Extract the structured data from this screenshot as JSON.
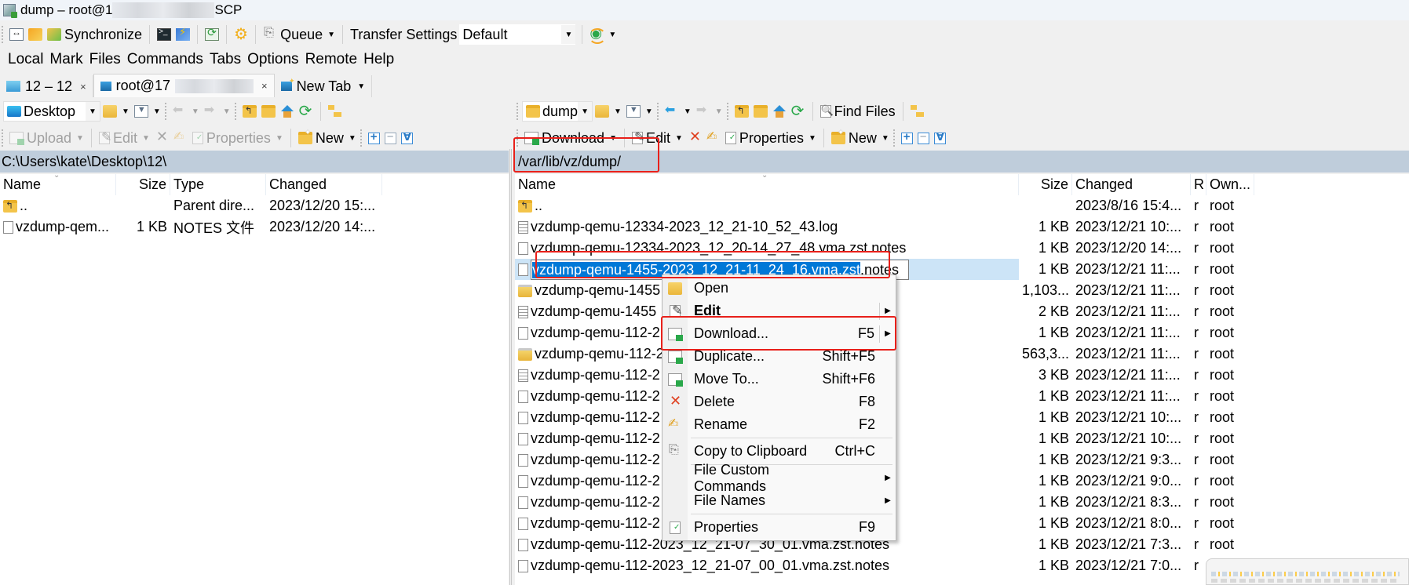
{
  "window": {
    "title_prefix": "dump – root@1",
    "title_suffix": "SCP"
  },
  "main_toolbar": {
    "synchronize_label": "Synchronize",
    "queue_label": "Queue",
    "transfer_settings_label": "Transfer Settings",
    "transfer_settings_value": "Default"
  },
  "menubar": {
    "items": [
      "Local",
      "Mark",
      "Files",
      "Commands",
      "Tabs",
      "Options",
      "Remote",
      "Help"
    ]
  },
  "tabs": [
    {
      "label": "12 – 12",
      "close": "×"
    },
    {
      "label": "root@17",
      "close": "×"
    },
    {
      "label": "New Tab"
    }
  ],
  "local": {
    "location": "Desktop",
    "toolbar": {
      "upload_label": "Upload",
      "edit_label": "Edit",
      "properties_label": "Properties",
      "new_label": "New"
    },
    "path": "C:\\Users\\kate\\Desktop\\12\\",
    "columns": [
      "Name",
      "Size",
      "Type",
      "Changed"
    ],
    "rows": [
      {
        "name": "..",
        "size": "",
        "type": "Parent dire...",
        "changed": "2023/12/20 15:...",
        "icon": "folder-up-icon"
      },
      {
        "name": "vzdump-qem...",
        "size": "1 KB",
        "type": "NOTES 文件",
        "changed": "2023/12/20 14:...",
        "icon": "file-icon"
      }
    ]
  },
  "remote": {
    "location": "dump",
    "toolbar": {
      "find_files_label": "Find Files",
      "download_label": "Download",
      "edit_label": "Edit",
      "properties_label": "Properties",
      "new_label": "New"
    },
    "path": "/var/lib/vz/dump/",
    "columns": [
      "Name",
      "Size",
      "Changed",
      "R",
      "Own..."
    ],
    "rows": [
      {
        "name": "..",
        "size": "",
        "changed": "2023/8/16 15:4...",
        "rights": "r",
        "owner": "root",
        "icon": "folder-up-icon"
      },
      {
        "name": "vzdump-qemu-12334-2023_12_21-10_52_43.log",
        "size": "1 KB",
        "changed": "2023/12/21 10:...",
        "rights": "r",
        "owner": "root",
        "icon": "text-file-icon"
      },
      {
        "name": "vzdump-qemu-12334-2023_12_20-14_27_48.vma.zst.notes",
        "size": "1 KB",
        "changed": "2023/12/20 14:...",
        "rights": "r",
        "owner": "root",
        "icon": "file-icon"
      },
      {
        "name": "vzdump-qemu-1455-2023_12_21-11_24_16.vma.zst.notes",
        "size": "1 KB",
        "changed": "2023/12/21 11:...",
        "rights": "r",
        "owner": "root",
        "icon": "file-icon",
        "selected": true
      },
      {
        "name": "vzdump-qemu-1455",
        "size": "1,103...",
        "changed": "2023/12/21 11:...",
        "rights": "r",
        "owner": "root",
        "icon": "archive-icon"
      },
      {
        "name": "vzdump-qemu-1455",
        "size": "2 KB",
        "changed": "2023/12/21 11:...",
        "rights": "r",
        "owner": "root",
        "icon": "text-file-icon"
      },
      {
        "name": "vzdump-qemu-112-2",
        "size": "1 KB",
        "changed": "2023/12/21 11:...",
        "rights": "r",
        "owner": "root",
        "icon": "file-icon"
      },
      {
        "name": "vzdump-qemu-112-2",
        "size": "563,3...",
        "changed": "2023/12/21 11:...",
        "rights": "r",
        "owner": "root",
        "icon": "archive-icon"
      },
      {
        "name": "vzdump-qemu-112-2",
        "size": "3 KB",
        "changed": "2023/12/21 11:...",
        "rights": "r",
        "owner": "root",
        "icon": "text-file-icon"
      },
      {
        "name": "vzdump-qemu-112-2",
        "size": "1 KB",
        "changed": "2023/12/21 11:...",
        "rights": "r",
        "owner": "root",
        "icon": "file-icon"
      },
      {
        "name": "vzdump-qemu-112-2",
        "size": "1 KB",
        "changed": "2023/12/21 10:...",
        "rights": "r",
        "owner": "root",
        "icon": "file-icon"
      },
      {
        "name": "vzdump-qemu-112-2",
        "size": "1 KB",
        "changed": "2023/12/21 10:...",
        "rights": "r",
        "owner": "root",
        "icon": "file-icon"
      },
      {
        "name": "vzdump-qemu-112-2",
        "size": "1 KB",
        "changed": "2023/12/21 9:3...",
        "rights": "r",
        "owner": "root",
        "icon": "file-icon"
      },
      {
        "name": "vzdump-qemu-112-2",
        "size": "1 KB",
        "changed": "2023/12/21 9:0...",
        "rights": "r",
        "owner": "root",
        "icon": "file-icon"
      },
      {
        "name": "vzdump-qemu-112-2",
        "size": "1 KB",
        "changed": "2023/12/21 8:3...",
        "rights": "r",
        "owner": "root",
        "icon": "file-icon"
      },
      {
        "name": "vzdump-qemu-112-2",
        "size": "1 KB",
        "changed": "2023/12/21 8:0...",
        "rights": "r",
        "owner": "root",
        "icon": "file-icon"
      },
      {
        "name": "vzdump-qemu-112-2023_12_21-07_30_01.vma.zst.notes",
        "size": "1 KB",
        "changed": "2023/12/21 7:3...",
        "rights": "r",
        "owner": "root",
        "icon": "file-icon"
      },
      {
        "name": "vzdump-qemu-112-2023_12_21-07_00_01.vma.zst.notes",
        "size": "1 KB",
        "changed": "2023/12/21 7:0...",
        "rights": "r",
        "owner": "",
        "icon": "file-icon"
      }
    ],
    "rename_edit": {
      "selected_text": "vzdump-qemu-1455-2023_12_21-11_24_16.vma.zst",
      "rest_text": ".notes"
    }
  },
  "context_menu": {
    "items": [
      {
        "label": "Open",
        "shortcut": "",
        "icon": "open-folder-icon",
        "submenu": false
      },
      {
        "label": "Edit",
        "shortcut": "",
        "icon": "edit-icon",
        "submenu": true,
        "bold": true
      },
      {
        "label": "Download...",
        "shortcut": "F5",
        "icon": "download-icon",
        "submenu": true
      },
      {
        "label": "Duplicate...",
        "shortcut": "Shift+F5",
        "icon": "duplicate-icon",
        "submenu": false
      },
      {
        "label": "Move To...",
        "shortcut": "Shift+F6",
        "icon": "move-icon",
        "submenu": false
      },
      {
        "label": "Delete",
        "shortcut": "F8",
        "icon": "delete-icon",
        "submenu": false
      },
      {
        "label": "Rename",
        "shortcut": "F2",
        "icon": "rename-icon",
        "submenu": false
      },
      {
        "label": "Copy to Clipboard",
        "shortcut": "Ctrl+C",
        "icon": "copy-icon",
        "submenu": false
      },
      {
        "label": "File Custom Commands",
        "shortcut": "",
        "icon": "",
        "submenu": true
      },
      {
        "label": "File Names",
        "shortcut": "",
        "icon": "",
        "submenu": true
      },
      {
        "label": "Properties",
        "shortcut": "F9",
        "icon": "properties-icon",
        "submenu": false
      }
    ]
  },
  "annotation_color": "#e8201a",
  "selection_color": "#cce4f7"
}
